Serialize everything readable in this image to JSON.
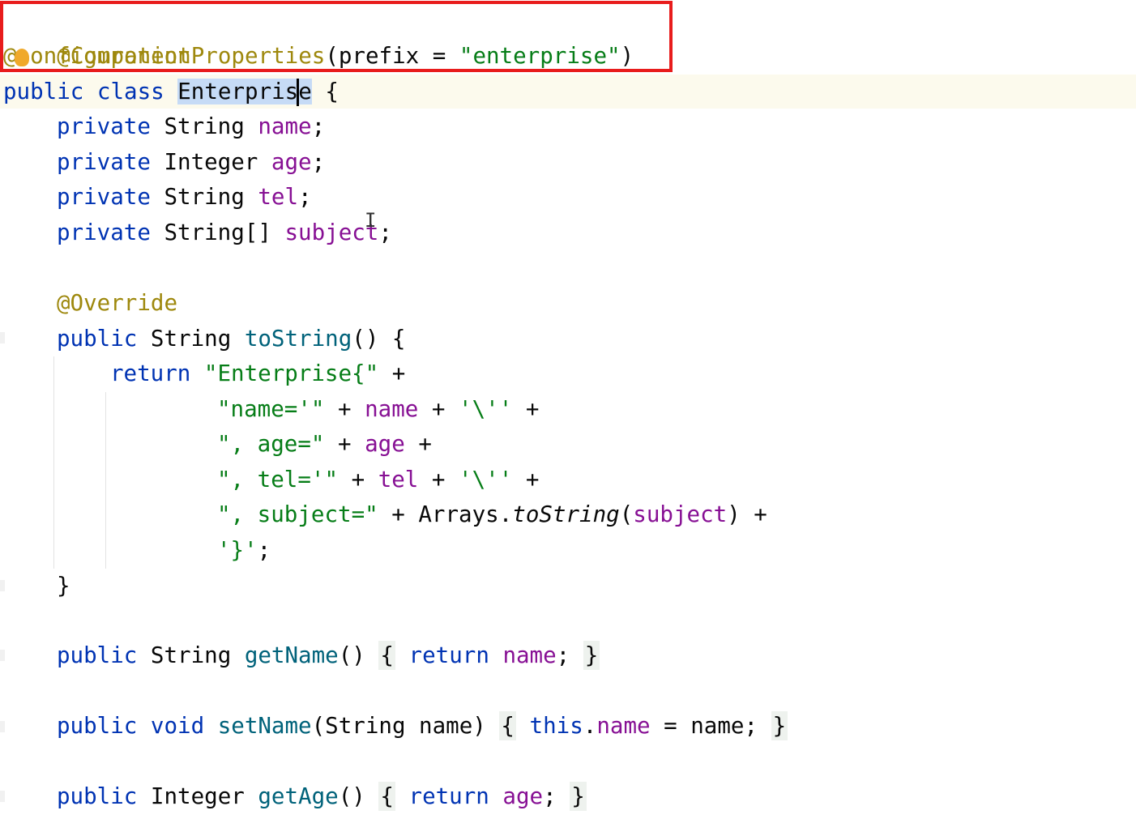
{
  "annotations": {
    "component": "@Component",
    "config_at": "@",
    "config_rest": "onfigurationProperties",
    "config_args_open": "(prefix = ",
    "config_prefix_value": "\"enterprise\"",
    "config_args_close": ")"
  },
  "class_decl": {
    "modifiers": "public class ",
    "name_selected": "Enterpris",
    "name_after_caret": "e",
    "brace": " {"
  },
  "fields": [
    {
      "modifier": "private ",
      "type": "String ",
      "name": "name",
      "end": ";"
    },
    {
      "modifier": "private ",
      "type": "Integer ",
      "name": "age",
      "end": ";"
    },
    {
      "modifier": "private ",
      "type": "String ",
      "name": "tel",
      "end": ";"
    },
    {
      "modifier": "private ",
      "type": "String[] ",
      "name": "subject",
      "end": ";"
    }
  ],
  "to_string": {
    "annotation": "@Override",
    "decl_mod": "public ",
    "decl_type": "String ",
    "decl_name": "toString",
    "decl_end": "() {",
    "return_kw": "return ",
    "s0": "\"Enterprise{\"",
    "s0_end": " +",
    "l1_str": "\"name='\"",
    "l1_op1": " + ",
    "l1_field": "name",
    "l1_op2": " + ",
    "l1_char": "'\\''",
    "l1_end": " +",
    "l2_str": "\", age=\"",
    "l2_op1": " + ",
    "l2_field": "age",
    "l2_end": " +",
    "l3_str": "\", tel='\"",
    "l3_op1": " + ",
    "l3_field": "tel",
    "l3_op2": " + ",
    "l3_char": "'\\''",
    "l3_end": " +",
    "l4_str": "\", subject=\"",
    "l4_op1": " + ",
    "l4_class": "Arrays.",
    "l4_method": "toString",
    "l4_open": "(",
    "l4_field": "subject",
    "l4_close": ")",
    "l4_end": " +",
    "l5_char": "'}'",
    "l5_end": ";",
    "close_brace": "}"
  },
  "get_name": {
    "mod": "public ",
    "type": "String ",
    "name": "getName",
    "paren": "()",
    "open": "{",
    "return_kw": "return ",
    "field": "name",
    "semi": ";",
    "close": "}"
  },
  "set_name": {
    "mod": "public ",
    "void_kw": "void ",
    "name": "setName",
    "params": "(String name) ",
    "open": "{",
    "this_kw": "this",
    "dot": ".",
    "field": "name",
    "assign": " = name;",
    "close": "}"
  },
  "get_age": {
    "mod": "public ",
    "type": "Integer ",
    "name": "getAge",
    "paren": "()",
    "open": "{",
    "return_kw": "return ",
    "field": "age",
    "semi": ";",
    "close": "}"
  },
  "colors": {
    "keyword": "#0033b3",
    "field": "#871094",
    "method": "#00627a",
    "string": "#067d17",
    "annotation": "#9e880d",
    "highlight_border": "#e81c1c",
    "selection": "#c6dbf6"
  },
  "icons": {
    "intention_bulb": "intention-bulb-icon",
    "mouse_cursor": "text-ibeam-cursor-icon"
  }
}
